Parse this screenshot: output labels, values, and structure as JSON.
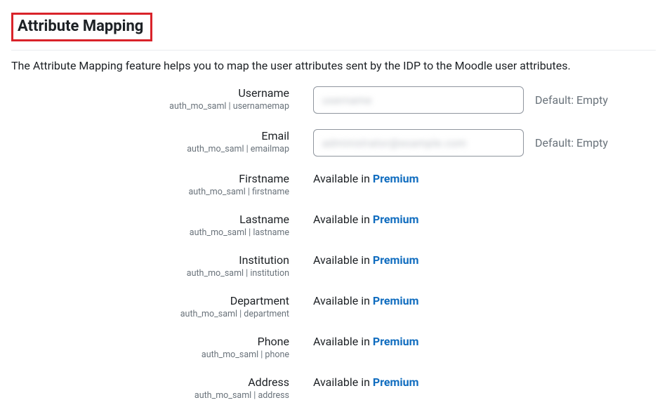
{
  "section": {
    "title": "Attribute Mapping",
    "intro": "The Attribute Mapping feature helps you to map the user attributes sent by the IDP to the Moodle user attributes."
  },
  "defaults": {
    "hint": "Default: Empty"
  },
  "premium": {
    "available_in": "Available in ",
    "label": "Premium"
  },
  "fields": {
    "username": {
      "label": "Username",
      "sub": "auth_mo_saml | usernamemap",
      "placeholder": ""
    },
    "email": {
      "label": "Email",
      "sub": "auth_mo_saml | emailmap",
      "placeholder": ""
    },
    "firstname": {
      "label": "Firstname",
      "sub": "auth_mo_saml | firstname"
    },
    "lastname": {
      "label": "Lastname",
      "sub": "auth_mo_saml | lastname"
    },
    "institution": {
      "label": "Institution",
      "sub": "auth_mo_saml | institution"
    },
    "department": {
      "label": "Department",
      "sub": "auth_mo_saml | department"
    },
    "phone": {
      "label": "Phone",
      "sub": "auth_mo_saml | phone"
    },
    "address": {
      "label": "Address",
      "sub": "auth_mo_saml | address"
    }
  }
}
